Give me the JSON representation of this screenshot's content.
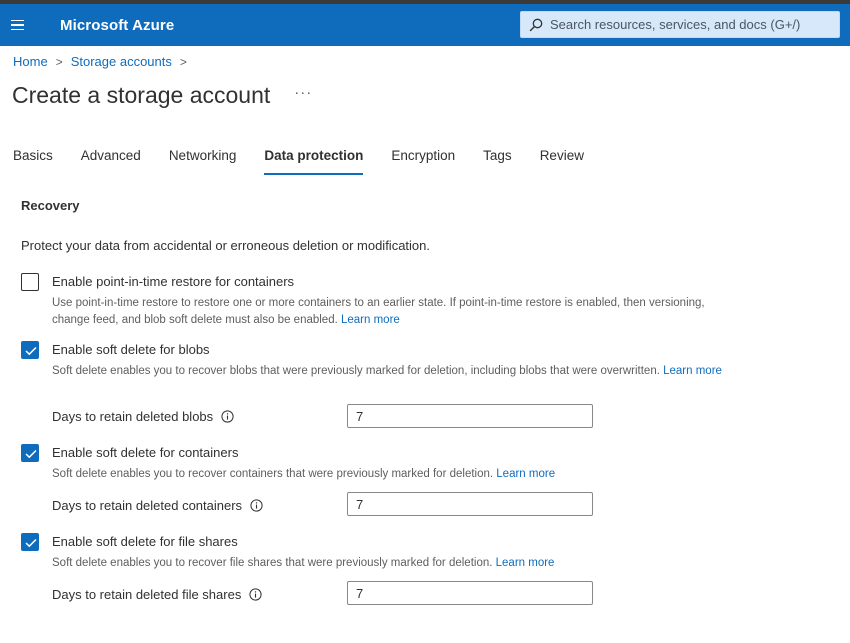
{
  "topbar": {
    "brand": "Microsoft Azure",
    "search_placeholder": "Search resources, services, and docs (G+/)"
  },
  "breadcrumb": {
    "items": [
      "Home",
      "Storage accounts"
    ]
  },
  "page": {
    "title": "Create a storage account",
    "more": "···"
  },
  "tabs": [
    "Basics",
    "Advanced",
    "Networking",
    "Data protection",
    "Encryption",
    "Tags",
    "Review"
  ],
  "active_tab": "Data protection",
  "recovery": {
    "title": "Recovery",
    "description": "Protect your data from accidental or erroneous deletion or modification.",
    "options": [
      {
        "label": "Enable point-in-time restore for containers",
        "checked": false,
        "description": "Use point-in-time restore to restore one or more containers to an earlier state. If point-in-time restore is enabled, then versioning, change feed, and blob soft delete must also be enabled.",
        "link": "Learn more"
      },
      {
        "label": "Enable soft delete for blobs",
        "checked": true,
        "description": "Soft delete enables you to recover blobs that were previously marked for deletion, including blobs that were overwritten.",
        "link": "Learn more",
        "field_label": "Days to retain deleted blobs",
        "field_value": "7"
      },
      {
        "label": "Enable soft delete for containers",
        "checked": true,
        "description": "Soft delete enables you to recover containers that were previously marked for deletion.",
        "link": "Learn more",
        "field_label": "Days to retain deleted containers",
        "field_value": "7"
      },
      {
        "label": "Enable soft delete for file shares",
        "checked": true,
        "description": "Soft delete enables you to recover file shares that were previously marked for deletion.",
        "link": "Learn more",
        "field_label": "Days to retain deleted file shares",
        "field_value": "7"
      }
    ]
  },
  "icons": {
    "menu": "hamburger-icon",
    "search": "search-icon",
    "breadcrumb_separator": "chevron-right-icon",
    "checkbox_checked": "checkmark-icon",
    "info": "info-icon"
  },
  "colors": {
    "header": "#0f6cbd",
    "link": "#0f6cbd",
    "checkbox_checked": "#0f6cbd"
  }
}
